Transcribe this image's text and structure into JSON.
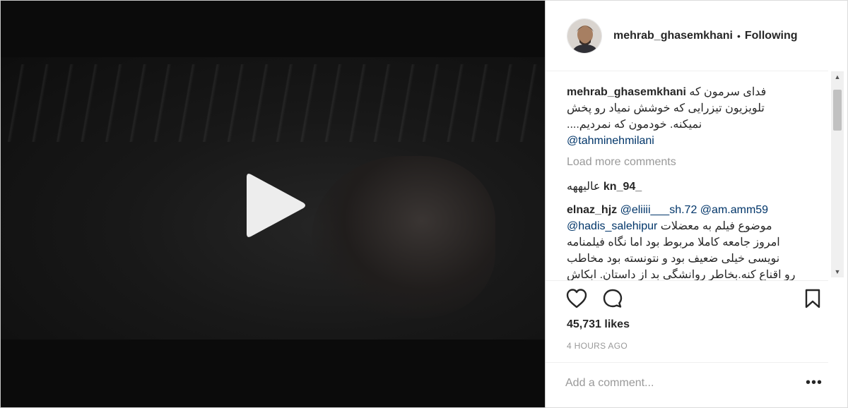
{
  "post": {
    "author": "mehrab_ghasemkhani",
    "separator": "•",
    "follow_status": "Following"
  },
  "comments": {
    "caption": {
      "user": "mehrab_ghasemkhani",
      "line1": "فدای سرمون که",
      "line2": "تلویزیون تیزرایی که خوشش نمیاد رو پخش",
      "line3": "نمیکنه. خودمون که نمردیم....",
      "mention": "@tahminehmilani"
    },
    "load_more": "Load more comments",
    "items": [
      {
        "user": "kn_94_",
        "text": "عالیههه"
      },
      {
        "user": "elnaz_hjz",
        "mention1": "@eliiii___sh.72",
        "mention2": "@am.amm59",
        "mention3": "@hadis_salehipur",
        "line1": "موضوع فیلم به معضلات",
        "line2": "امروز جامعه کاملا مربوط بود اما نگاه فیلمنامه",
        "line3": "نویسی خیلی ضعیف بود و نتونسته بود مخاطب",
        "line4": "رو اقناع کنه.بخاطر روانشگی بد از داستان. ابکاش"
      }
    ]
  },
  "stats": {
    "likes": "45,731 likes",
    "time_ago": "4 HOURS AGO"
  },
  "add_comment": {
    "placeholder": "Add a comment...",
    "more_label": "•••"
  },
  "icons": {
    "play": "play-icon",
    "like": "heart-icon",
    "comment": "comment-bubble-icon",
    "save": "bookmark-icon",
    "more": "more-options-icon"
  },
  "colors": {
    "text": "#262626",
    "muted": "#999999",
    "mention": "#003569",
    "border": "#efefef"
  }
}
